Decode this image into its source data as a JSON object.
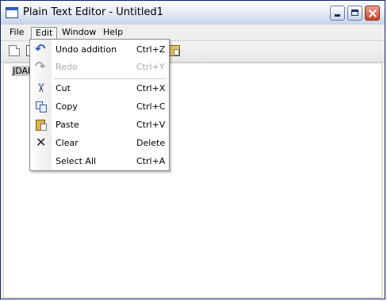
{
  "window": {
    "title": "Plain Text Editor - Untitled1",
    "icons": [
      "app-window-icon",
      "minimize-icon",
      "maximize-icon",
      "close-icon"
    ]
  },
  "menubar": {
    "file": "File",
    "edit": "Edit",
    "window": "Window",
    "help": "Help"
  },
  "editor": {
    "text": "JDAF"
  },
  "edit_menu": {
    "items": [
      {
        "label": "Undo addition",
        "shortcut": "Ctrl+Z",
        "icon": "undo-icon",
        "enabled": true
      },
      {
        "label": "Redo",
        "shortcut": "Ctrl+Y",
        "icon": "redo-icon",
        "enabled": false
      },
      {
        "label": "Cut",
        "shortcut": "Ctrl+X",
        "icon": "cut-icon",
        "enabled": true
      },
      {
        "label": "Copy",
        "shortcut": "Ctrl+C",
        "icon": "copy-icon",
        "enabled": true
      },
      {
        "label": "Paste",
        "shortcut": "Ctrl+V",
        "icon": "paste-icon",
        "enabled": true
      },
      {
        "label": "Clear",
        "shortcut": "Delete",
        "icon": "clear-icon",
        "enabled": true
      },
      {
        "label": "Select All",
        "shortcut": "Ctrl+A",
        "icon": "",
        "enabled": true
      }
    ]
  }
}
